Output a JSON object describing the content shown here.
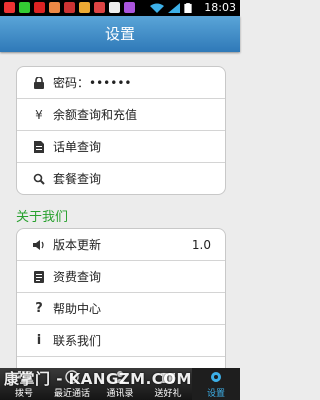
{
  "status_bar": {
    "time": "18:03"
  },
  "header": {
    "title": "设置"
  },
  "account": {
    "items": [
      {
        "icon": "lock-icon",
        "label": "密码：••••••"
      },
      {
        "icon": "yen-icon",
        "label": "余额查询和充值"
      },
      {
        "icon": "bill-icon",
        "label": "话单查询"
      },
      {
        "icon": "search-icon",
        "label": "套餐查询"
      }
    ]
  },
  "about": {
    "title": "关于我们",
    "items": [
      {
        "icon": "speaker-icon",
        "label": "版本更新",
        "value": "1.0"
      },
      {
        "icon": "document-icon",
        "label": "资费查询"
      },
      {
        "icon": "question-icon",
        "label": "帮助中心"
      },
      {
        "icon": "info-icon",
        "label": "联系我们"
      }
    ]
  },
  "bottom_nav": [
    {
      "icon": "dialpad-icon",
      "label": "拨号"
    },
    {
      "icon": "clock-icon",
      "label": "最近通话"
    },
    {
      "icon": "contacts-icon",
      "label": "通讯录"
    },
    {
      "icon": "gift-icon",
      "label": "送好礼"
    },
    {
      "icon": "gear-icon",
      "label": "设置"
    }
  ],
  "watermark": "康掌门 - KANGZM.COM"
}
